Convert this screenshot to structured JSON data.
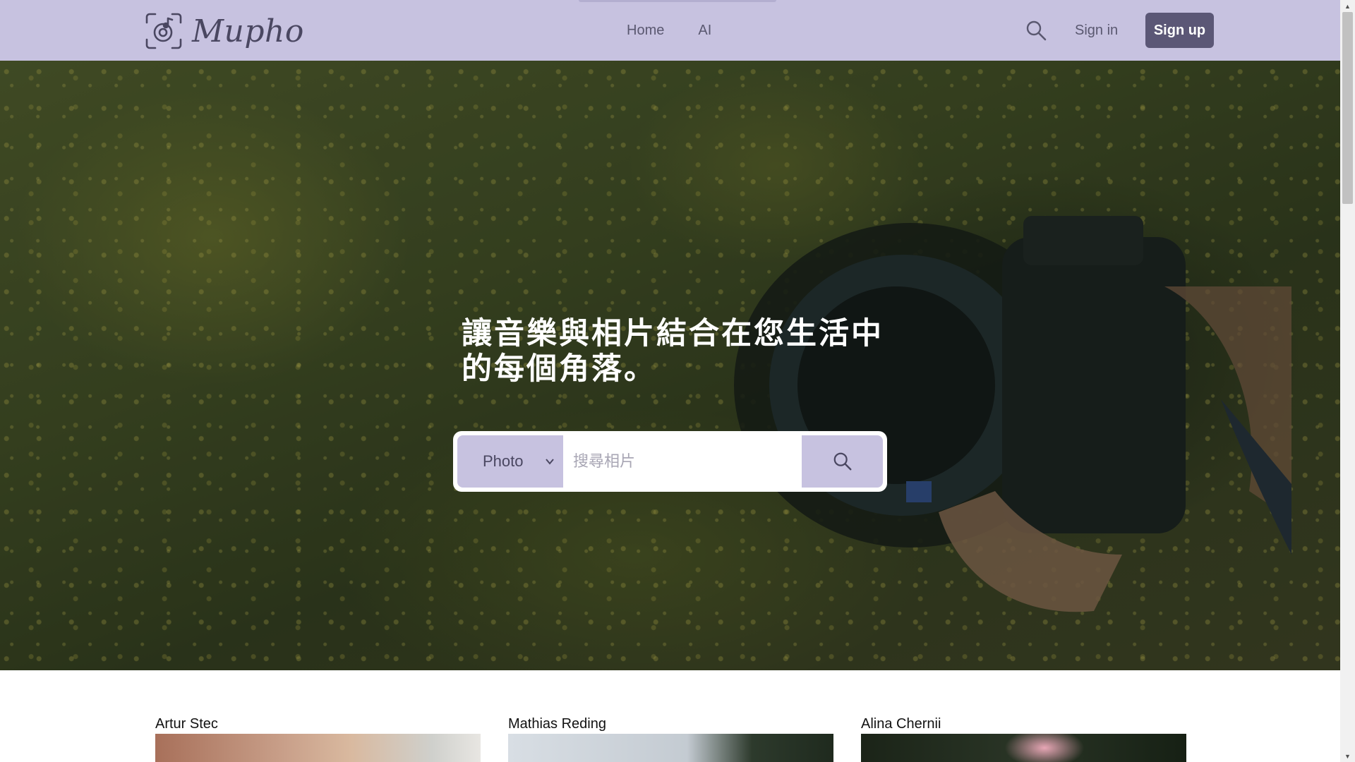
{
  "nav": {
    "brand": "Mupho",
    "links": [
      {
        "label": "Home"
      },
      {
        "label": "AI"
      }
    ],
    "signin_label": "Sign in",
    "signup_label": "Sign up",
    "search_icon": "search-icon"
  },
  "hero": {
    "headline": "讓音樂與相片結合在您生活中的每個角落。",
    "search": {
      "selected_option": "Photo",
      "placeholder": "搜尋相片",
      "value": ""
    }
  },
  "gallery": {
    "cards": [
      {
        "author": "Artur Stec"
      },
      {
        "author": "Mathias Reding"
      },
      {
        "author": "Alina Chernii"
      }
    ]
  },
  "colors": {
    "navbar": "#c7c2e0",
    "accent": "#5b5776",
    "text_muted": "#5a5870"
  }
}
